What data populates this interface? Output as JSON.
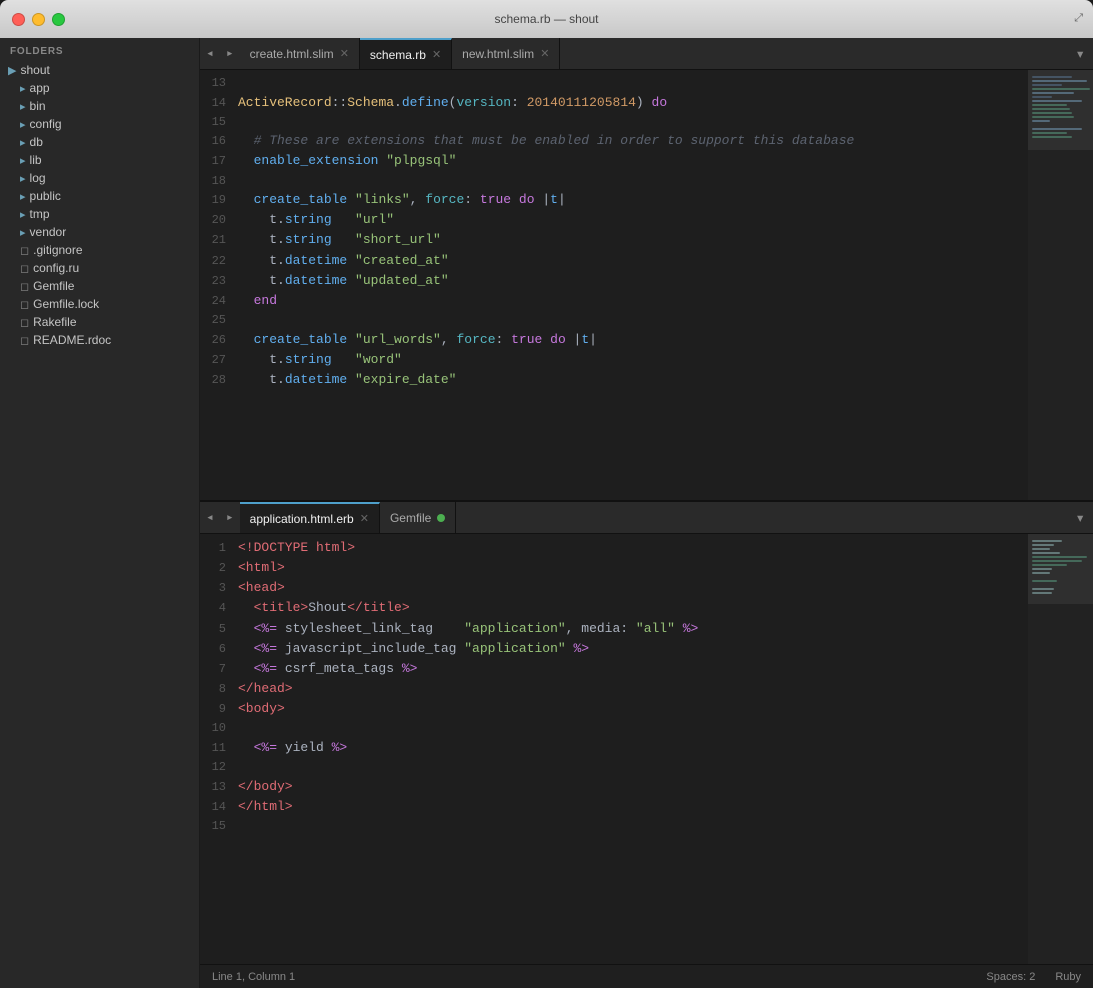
{
  "titlebar": {
    "title": "schema.rb — shout",
    "buttons": [
      "close",
      "minimize",
      "maximize"
    ]
  },
  "sidebar": {
    "header": "FOLDERS",
    "root": "shout",
    "folders": [
      {
        "name": "app",
        "indent": 1,
        "type": "folder"
      },
      {
        "name": "bin",
        "indent": 1,
        "type": "folder"
      },
      {
        "name": "config",
        "indent": 1,
        "type": "folder"
      },
      {
        "name": "db",
        "indent": 1,
        "type": "folder"
      },
      {
        "name": "lib",
        "indent": 1,
        "type": "folder"
      },
      {
        "name": "log",
        "indent": 1,
        "type": "folder"
      },
      {
        "name": "public",
        "indent": 1,
        "type": "folder"
      },
      {
        "name": "tmp",
        "indent": 1,
        "type": "folder"
      },
      {
        "name": "vendor",
        "indent": 1,
        "type": "folder"
      },
      {
        "name": ".gitignore",
        "indent": 1,
        "type": "file"
      },
      {
        "name": "config.ru",
        "indent": 1,
        "type": "file"
      },
      {
        "name": "Gemfile",
        "indent": 1,
        "type": "file"
      },
      {
        "name": "Gemfile.lock",
        "indent": 1,
        "type": "file"
      },
      {
        "name": "Rakefile",
        "indent": 1,
        "type": "file"
      },
      {
        "name": "README.rdoc",
        "indent": 1,
        "type": "file"
      }
    ]
  },
  "top_tabs": [
    {
      "label": "create.html.slim",
      "active": false,
      "closeable": true
    },
    {
      "label": "schema.rb",
      "active": true,
      "closeable": true
    },
    {
      "label": "new.html.slim",
      "active": false,
      "closeable": true
    }
  ],
  "bottom_tabs": [
    {
      "label": "application.html.erb",
      "active": true,
      "closeable": true,
      "modified": false
    },
    {
      "label": "Gemfile",
      "active": false,
      "closeable": false,
      "modified": true
    }
  ],
  "top_code": [
    {
      "num": "13",
      "content": ""
    },
    {
      "num": "14",
      "content": "ActiveRecord::Schema.define(version: 20140111205814) do"
    },
    {
      "num": "15",
      "content": ""
    },
    {
      "num": "16",
      "content": "  # These are extensions that must be enabled in order to support this database"
    },
    {
      "num": "17",
      "content": "  enable_extension \"plpgsql\""
    },
    {
      "num": "18",
      "content": ""
    },
    {
      "num": "19",
      "content": "  create_table \"links\", force: true do |t|"
    },
    {
      "num": "20",
      "content": "    t.string   \"url\""
    },
    {
      "num": "21",
      "content": "    t.string   \"short_url\""
    },
    {
      "num": "22",
      "content": "    t.datetime \"created_at\""
    },
    {
      "num": "23",
      "content": "    t.datetime \"updated_at\""
    },
    {
      "num": "24",
      "content": "  end"
    },
    {
      "num": "25",
      "content": ""
    },
    {
      "num": "26",
      "content": "  create_table \"url_words\", force: true do |t|"
    },
    {
      "num": "27",
      "content": "    t.string   \"word\""
    },
    {
      "num": "28",
      "content": "    t.datetime \"expire_date\""
    }
  ],
  "bottom_code": [
    {
      "num": "1",
      "content": "<!DOCTYPE html>"
    },
    {
      "num": "2",
      "content": "<html>"
    },
    {
      "num": "3",
      "content": "<head>"
    },
    {
      "num": "4",
      "content": "  <title>Shout</title>"
    },
    {
      "num": "5",
      "content": "  <%= stylesheet_link_tag    \"application\", media: \"all\" %>"
    },
    {
      "num": "6",
      "content": "  <%= javascript_include_tag \"application\" %>"
    },
    {
      "num": "7",
      "content": "  <%= csrf_meta_tags %>"
    },
    {
      "num": "8",
      "content": "</head>"
    },
    {
      "num": "9",
      "content": "<body>"
    },
    {
      "num": "10",
      "content": ""
    },
    {
      "num": "11",
      "content": "  <%= yield %>"
    },
    {
      "num": "12",
      "content": ""
    },
    {
      "num": "13",
      "content": "</body>"
    },
    {
      "num": "14",
      "content": "</html>"
    },
    {
      "num": "15",
      "content": ""
    }
  ],
  "status_bar": {
    "position": "Line 1, Column 1",
    "spaces": "Spaces: 2",
    "language": "Ruby"
  }
}
